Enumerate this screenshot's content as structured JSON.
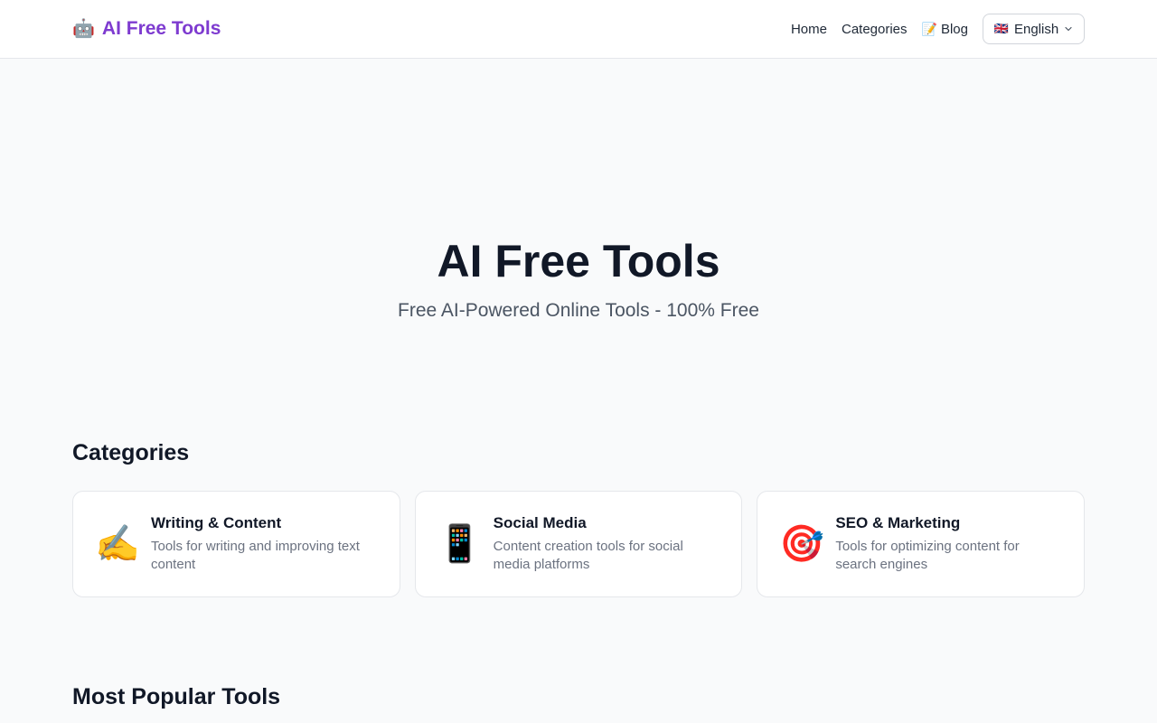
{
  "header": {
    "logo_icon": "🤖",
    "logo_text": "AI Free Tools",
    "nav": [
      {
        "label": "Home"
      },
      {
        "label": "Categories"
      },
      {
        "label": "Blog",
        "emoji": "📝"
      }
    ],
    "language": {
      "flag": "🇬🇧",
      "label": "English"
    }
  },
  "hero": {
    "title": "AI Free Tools",
    "subtitle": "Free AI-Powered Online Tools - 100% Free"
  },
  "categories": {
    "title": "Categories",
    "items": [
      {
        "icon": "✍️",
        "title": "Writing & Content",
        "description": "Tools for writing and improving text content"
      },
      {
        "icon": "📱",
        "title": "Social Media",
        "description": "Content creation tools for social media platforms"
      },
      {
        "icon": "🎯",
        "title": "SEO & Marketing",
        "description": "Tools for optimizing content for search engines"
      }
    ]
  },
  "popular": {
    "title": "Most Popular Tools"
  },
  "colors": {
    "brand": "#7e3bd0",
    "background": "#f9fafb"
  }
}
